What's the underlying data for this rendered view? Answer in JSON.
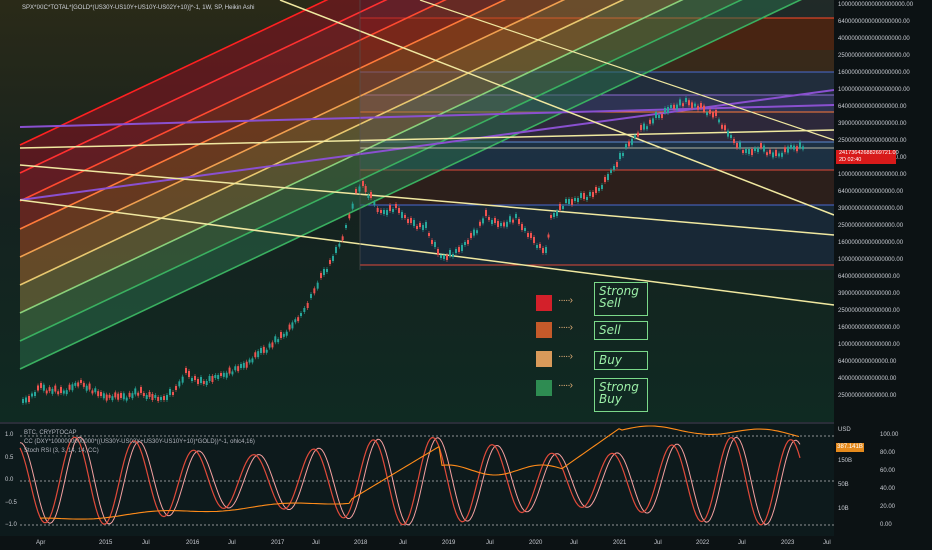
{
  "chart_title": "SPX*IXIC*TOTAL*[GOLD*(US30Y-US10Y+US10Y-US02Y+10)]^-1, 1W, SP, Heikin Ashi",
  "oscillator_legend": [
    "BTC, CRYPTOCAP",
    "CC (DXY*1000000000000*((US30Y-US02Y+US30Y-US10Y+10)*GOLD))^-1, ohlc4,16)",
    "Stoch RSI (3, 3, 14, 14, CC)"
  ],
  "price_tag": {
    "value": "24173642688269721.00",
    "countdown": "2D 02:40"
  },
  "right_axis_labels": [
    "10000000000000000000.00",
    "6400000000000000000.00",
    "4000000000000000000.00",
    "2500000000000000000.00",
    "1600000000000000000.00",
    "1000000000000000000.00",
    "640000000000000000.00",
    "390000000000000000.00",
    "250000000000000000.00",
    "160000000000000000.00",
    "100000000000000000.00",
    "64000000000000000.00",
    "39000000000000000.00",
    "25000000000000000.00",
    "16000000000000000.00",
    "10000000000000000.00",
    "6400000000000000.00",
    "3900000000000000.00",
    "2500000000000000.00",
    "1600000000000000.00",
    "1000000000000000.00",
    "640000000000000.00",
    "400000000000000.00",
    "250000000000000.00"
  ],
  "legend": [
    {
      "label": "Strong\nSell",
      "color": "#d3202a"
    },
    {
      "label": "Sell",
      "color": "#c55a2a"
    },
    {
      "label": "Buy",
      "color": "#d99a5a"
    },
    {
      "label": "Strong\nBuy",
      "color": "#2e8c52"
    }
  ],
  "osc_left_axis": [
    "1.0",
    "0.5",
    "0.0",
    "−0.5",
    "−1.0"
  ],
  "osc_right_axis": [
    "100.00",
    "80.00",
    "60.00",
    "40.00",
    "20.00",
    "0.00"
  ],
  "osc_mid_axis": [
    "150B",
    "50B",
    "10B"
  ],
  "osc_unit": "USD",
  "osc_value_tag": "387.141B",
  "x_axis_labels": [
    "Apr",
    "2015",
    "Jul",
    "2016",
    "Jul",
    "2017",
    "Jul",
    "2018",
    "Jul",
    "2019",
    "Jul",
    "2020",
    "Jul",
    "2021",
    "Jul",
    "2022",
    "Jul",
    "2023",
    "Jul"
  ],
  "colors": {
    "strong_sell": "#d3202a",
    "sell": "#c55a2a",
    "buy": "#d99a5a",
    "strong_buy": "#2e8c52",
    "stoch_k": "#e04a3a",
    "stoch_d": "#f4a0a0",
    "btc_line": "#ff8c1a"
  }
}
